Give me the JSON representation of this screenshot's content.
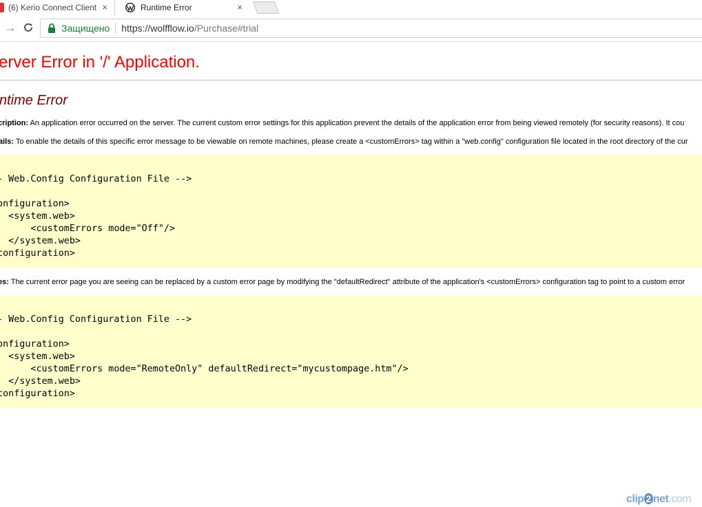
{
  "tabs": [
    {
      "title": "(6) Kerio Connect Client",
      "active": false,
      "close": "×"
    },
    {
      "title": "Runtime Error",
      "active": true,
      "close": "×"
    }
  ],
  "toolbar": {
    "back_icon": "→",
    "reload_icon": "C",
    "secure_label": "Защищено",
    "url_host": "https://wolfflow.io",
    "url_path": "/Purchase#trial"
  },
  "page": {
    "title": "erver Error in '/' Application.",
    "subtitle": "ntime Error",
    "description_label": "cription:",
    "description_text": " An application error occurred on the server. The current custom error settings for this application prevent the details of the application error from being viewed remotely (for security reasons). It cou",
    "details_label": "ails:",
    "details_text": " To enable the details of this specific error message to be viewable on remote machines, please create a <customErrors> tag within a \"web.config\" configuration file located in the root directory of the cur",
    "code1": "-- Web.Config Configuration File -->\n\nconfiguration>\n   <system.web>\n       <customErrors mode=\"Off\"/>\n   </system.web>\n/configuration>",
    "notes_label": "es:",
    "notes_text": " The current error page you are seeing can be replaced by a custom error page by modifying the \"defaultRedirect\" attribute of the application's <customErrors> configuration tag to point to a custom error",
    "code2": "-- Web.Config Configuration File -->\n\nconfiguration>\n   <system.web>\n       <customErrors mode=\"RemoteOnly\" defaultRedirect=\"mycustompage.htm\"/>\n   </system.web>\n/configuration>"
  },
  "watermark": {
    "left": "clip",
    "mid": "2",
    "right": "net",
    "com": ".com"
  },
  "colors": {
    "title_red": "#ff0000",
    "subtitle_maroon": "#800000",
    "code_bg": "#ffffcc",
    "secure_green": "#188038"
  }
}
